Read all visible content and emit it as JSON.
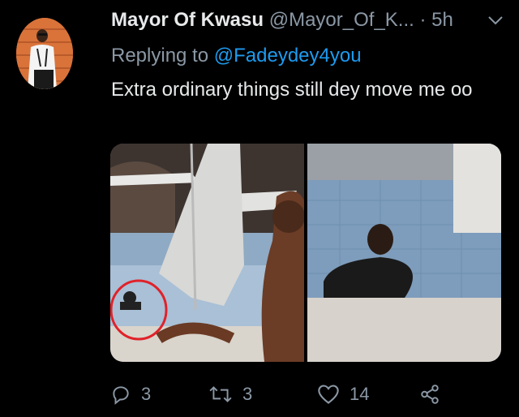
{
  "tweet": {
    "display_name": "Mayor Of Kwasu",
    "handle": "@Mayor_Of_K...",
    "separator": "·",
    "time": "5h",
    "replying_prefix": "Replying to",
    "replying_to": "@Fadeydey4you",
    "text": "Extra ordinary things still dey move me oo",
    "media_count": 2
  },
  "actions": {
    "replies": "3",
    "retweets": "3",
    "likes": "14"
  },
  "icons": {
    "reply": "reply-icon",
    "retweet": "retweet-icon",
    "like": "heart-icon",
    "share": "share-icon",
    "more": "chevron-down-icon"
  },
  "colors": {
    "background": "#000000",
    "primary_text": "#e7e9ea",
    "secondary_text": "#8b98a5",
    "link": "#1d9bf0",
    "annotation_circle": "#e0222a"
  }
}
